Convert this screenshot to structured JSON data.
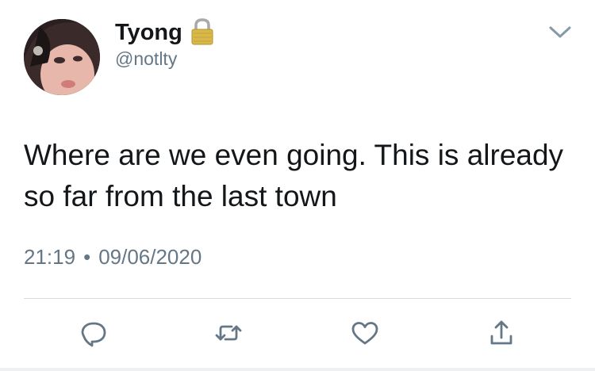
{
  "user": {
    "display_name": "Tyong",
    "handle": "@notlty",
    "avatar_icon": "profile-photo",
    "lock_icon": "lock-icon"
  },
  "tweet": {
    "text": "Where are we even going. This is already so far from the last town",
    "time": "21:19",
    "date": "09/06/2020",
    "separator": "•"
  },
  "actions": {
    "reply_icon": "reply-icon",
    "retweet_icon": "retweet-icon",
    "like_icon": "heart-icon",
    "share_icon": "share-icon"
  },
  "colors": {
    "text": "#14171a",
    "muted": "#657786",
    "icon": "#657786",
    "divider": "#d6dbdf"
  }
}
